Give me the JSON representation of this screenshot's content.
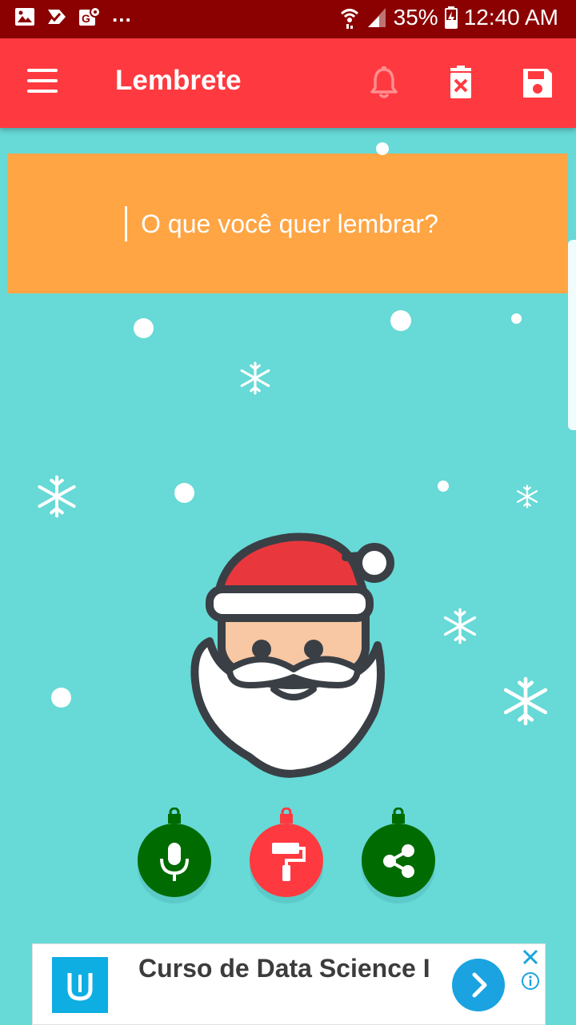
{
  "status_bar": {
    "notifications_more": "...",
    "battery": "35%",
    "time": "12:40 AM"
  },
  "app_bar": {
    "title": "Lembrete",
    "icons": [
      "menu-icon",
      "bell-icon",
      "delete-icon",
      "save-icon"
    ]
  },
  "reminder": {
    "placeholder": "O que você quer lembrar?",
    "value": ""
  },
  "actions": [
    {
      "name": "microphone",
      "icon": "microphone-icon",
      "color": "#006b00"
    },
    {
      "name": "color",
      "icon": "paint-roller-icon",
      "color": "#fe3a40"
    },
    {
      "name": "share",
      "icon": "share-icon",
      "color": "#006b00"
    }
  ],
  "ad": {
    "text": "Curso de Data Science I",
    "logo": "udacity-logo",
    "accent": "#0eaee3"
  },
  "colors": {
    "background": "#67d9d6",
    "app_bar": "#fe3a40",
    "status_bar": "#8b0000",
    "reminder_box": "#ffa544"
  }
}
